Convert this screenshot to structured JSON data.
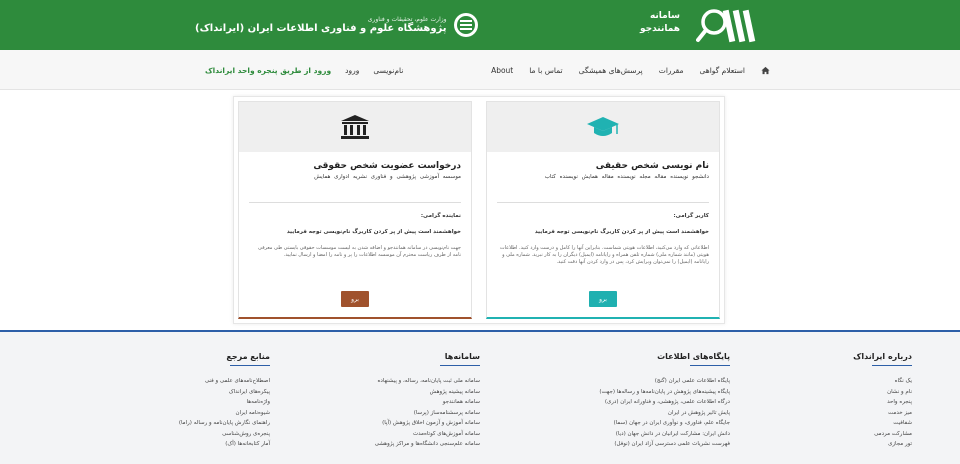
{
  "header": {
    "brand": [
      "سامانه",
      "همانندجو"
    ],
    "institute_sub": "وزارت علوم، تحقیقات و فناوری",
    "institute_main": "پژوهشگاه علوم و فناوری اطلاعات ایران (ایرانداک)"
  },
  "nav": {
    "home_icon": "home-icon",
    "items": [
      "استعلام گواهی",
      "مقررات",
      "پرسش‌های همیشگی",
      "تماس با ما",
      "About"
    ],
    "auth": [
      "نام‌نویسی",
      "ورود"
    ],
    "irandoc_login": "ورود از طریق پنجره واحد ایرانداک"
  },
  "cards": {
    "real": {
      "title": "نام نویسی شخص حقیقی",
      "tags": "دانشجو   نویسنده مقاله مجله   نویسنده مقاله همایش   نویسنده کتاب",
      "greet": "کاربر گرامی:",
      "note": "خواهشمند است پیش از پر کردن کاربرگ نام‌نویسی توجه فرمایید",
      "desc": "اطلاعاتی که وارد می‌کنید، اطلاعات هویتی شماست. بنابراین آنها را کامل و درست وارد کنید. اطلاعات هویتی (مانند شماره ملی) شماره تلفن همراه و رایانامه (ایمیل) دیگران را به کار نبرید. شماره ملی و رایانامه (ایمیل) را نمی‌توان ویرایش کرد، پس در وارد کردن آنها دقت کنید.",
      "button": "برو"
    },
    "legal": {
      "title": "درخواست عضویت شخص حقوقی",
      "tags": "موسسه آموزشی پژوهشی و فناوری   نشریه ادواری   همایش",
      "greet": "نماینده گرامی:",
      "note": "خواهشمند است پیش از پر کردن کاربرگ نام‌نویسی توجه فرمایید",
      "desc": "جهت نام‌نویسی در سامانه همانندجو و اضافه شدن به لیست موسسات حقوقی بایستی طی معرفی نامه از طرف ریاست محترم آن موسسه اطلاعات را پر و نامه را امضا و ارسال نمایید.",
      "button": "برو"
    }
  },
  "footer": {
    "about": {
      "title": "درباره ایرانداک",
      "items": [
        "یک نگاه",
        "نام و نشان",
        "پنجره واحد",
        "میز خدمت",
        "شفافیت",
        "مشارکت مردمی",
        "تور مجازی"
      ]
    },
    "databases": {
      "title": "پایگاه‌های اطلاعات",
      "items": [
        "پایگاه اطلاعات علمی ایران (گنج)",
        "پایگاه پیشینه‌های پژوهش در پایان‌نامه‌ها و رساله‌ها (جهت)",
        "درگاه اطلاعات علمی، پژوهشی، و فناورانه ایران (دری)",
        "پایش تاثیر پژوهش در ایران",
        "جایگاه علم، فناوری، و نوآوری ایران در جهان (سما)",
        "دانش ایران: مشارکت ایرانیان در دانش جهان (دیا)",
        "فهرست نشریات علمی دسترسی آزاد ایران (نوفل)"
      ]
    },
    "systems": {
      "title": "سامانه‌ها",
      "items": [
        "سامانه ملی ثبت پایان‌نامه، رساله، و پیشنهاده",
        "سامانه پیشینه پژوهش",
        "سامانه همانندجو",
        "سامانه پرسشنامه‌ساز (پرسا)",
        "سامانه آموزش و آزمون اخلاق پژوهش (آپا)",
        "سامانه آموزش‌های کوتاه‌مدت",
        "سامانه علم‌سنجی دانشگاه‌ها و مراکز پژوهشی"
      ]
    },
    "references": {
      "title": "منابع مرجع",
      "items": [
        "اصطلاح‌نامه‌های علمی و فنی",
        "پیکره‌های ایرانداک",
        "واژه‌نامه‌ها",
        "شیوه‌نامه ایران",
        "راهنمای نگارش پایان‌نامه و رساله (راما)",
        "پنجره‌ی روش‌شناسی",
        "آمار کتابخانه‌ها (آک)"
      ]
    }
  }
}
